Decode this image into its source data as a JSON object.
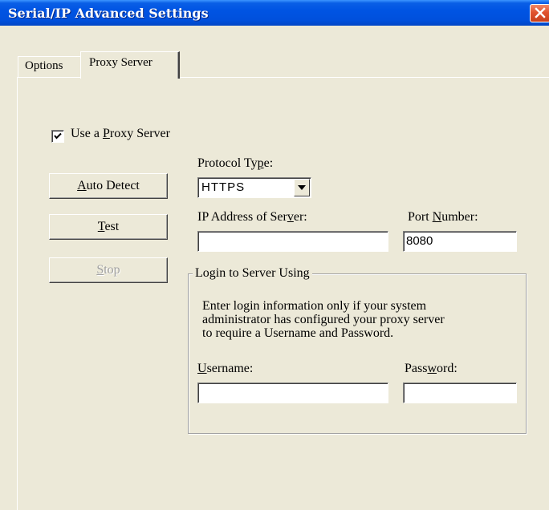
{
  "window": {
    "title": "Serial/IP Advanced Settings"
  },
  "tabs": [
    {
      "label": "Options",
      "active": false
    },
    {
      "label": "Proxy Server",
      "active": true
    }
  ],
  "proxy": {
    "use_proxy_label_pre": "Use a ",
    "use_proxy_label_key": "P",
    "use_proxy_label_post": "roxy Server",
    "use_proxy_checked": true,
    "protocol_label_pre": "Protocol Ty",
    "protocol_label_key": "p",
    "protocol_label_post": "e:",
    "protocol_value": "HTTPS",
    "ip_label_pre": "IP Address of Ser",
    "ip_label_key": "v",
    "ip_label_post": "er:",
    "ip_value": "",
    "port_label_pre": "Port ",
    "port_label_key": "N",
    "port_label_post": "umber:",
    "port_value": "8080"
  },
  "buttons": {
    "auto_detect_key": "A",
    "auto_detect_rest": "uto Detect",
    "test_key": "T",
    "test_rest": "est",
    "stop_key": "S",
    "stop_rest": "top"
  },
  "login": {
    "group_title": "Login to Server Using",
    "description": [
      "Enter login information only if your system",
      "administrator has configured your proxy server",
      "to require a Username and Password."
    ],
    "username_label_key": "U",
    "username_label_rest": "sername:",
    "username_value": "",
    "password_label_pre": "Pass",
    "password_label_key": "w",
    "password_label_post": "ord:",
    "password_value": ""
  },
  "colors": {
    "titlebar": "#0054e3",
    "window_bg": "#ece9d8",
    "close": "#e0522e"
  },
  "icons": {
    "close": "close-icon",
    "check": "checkmark-icon",
    "dropdown": "chevron-down-icon"
  }
}
